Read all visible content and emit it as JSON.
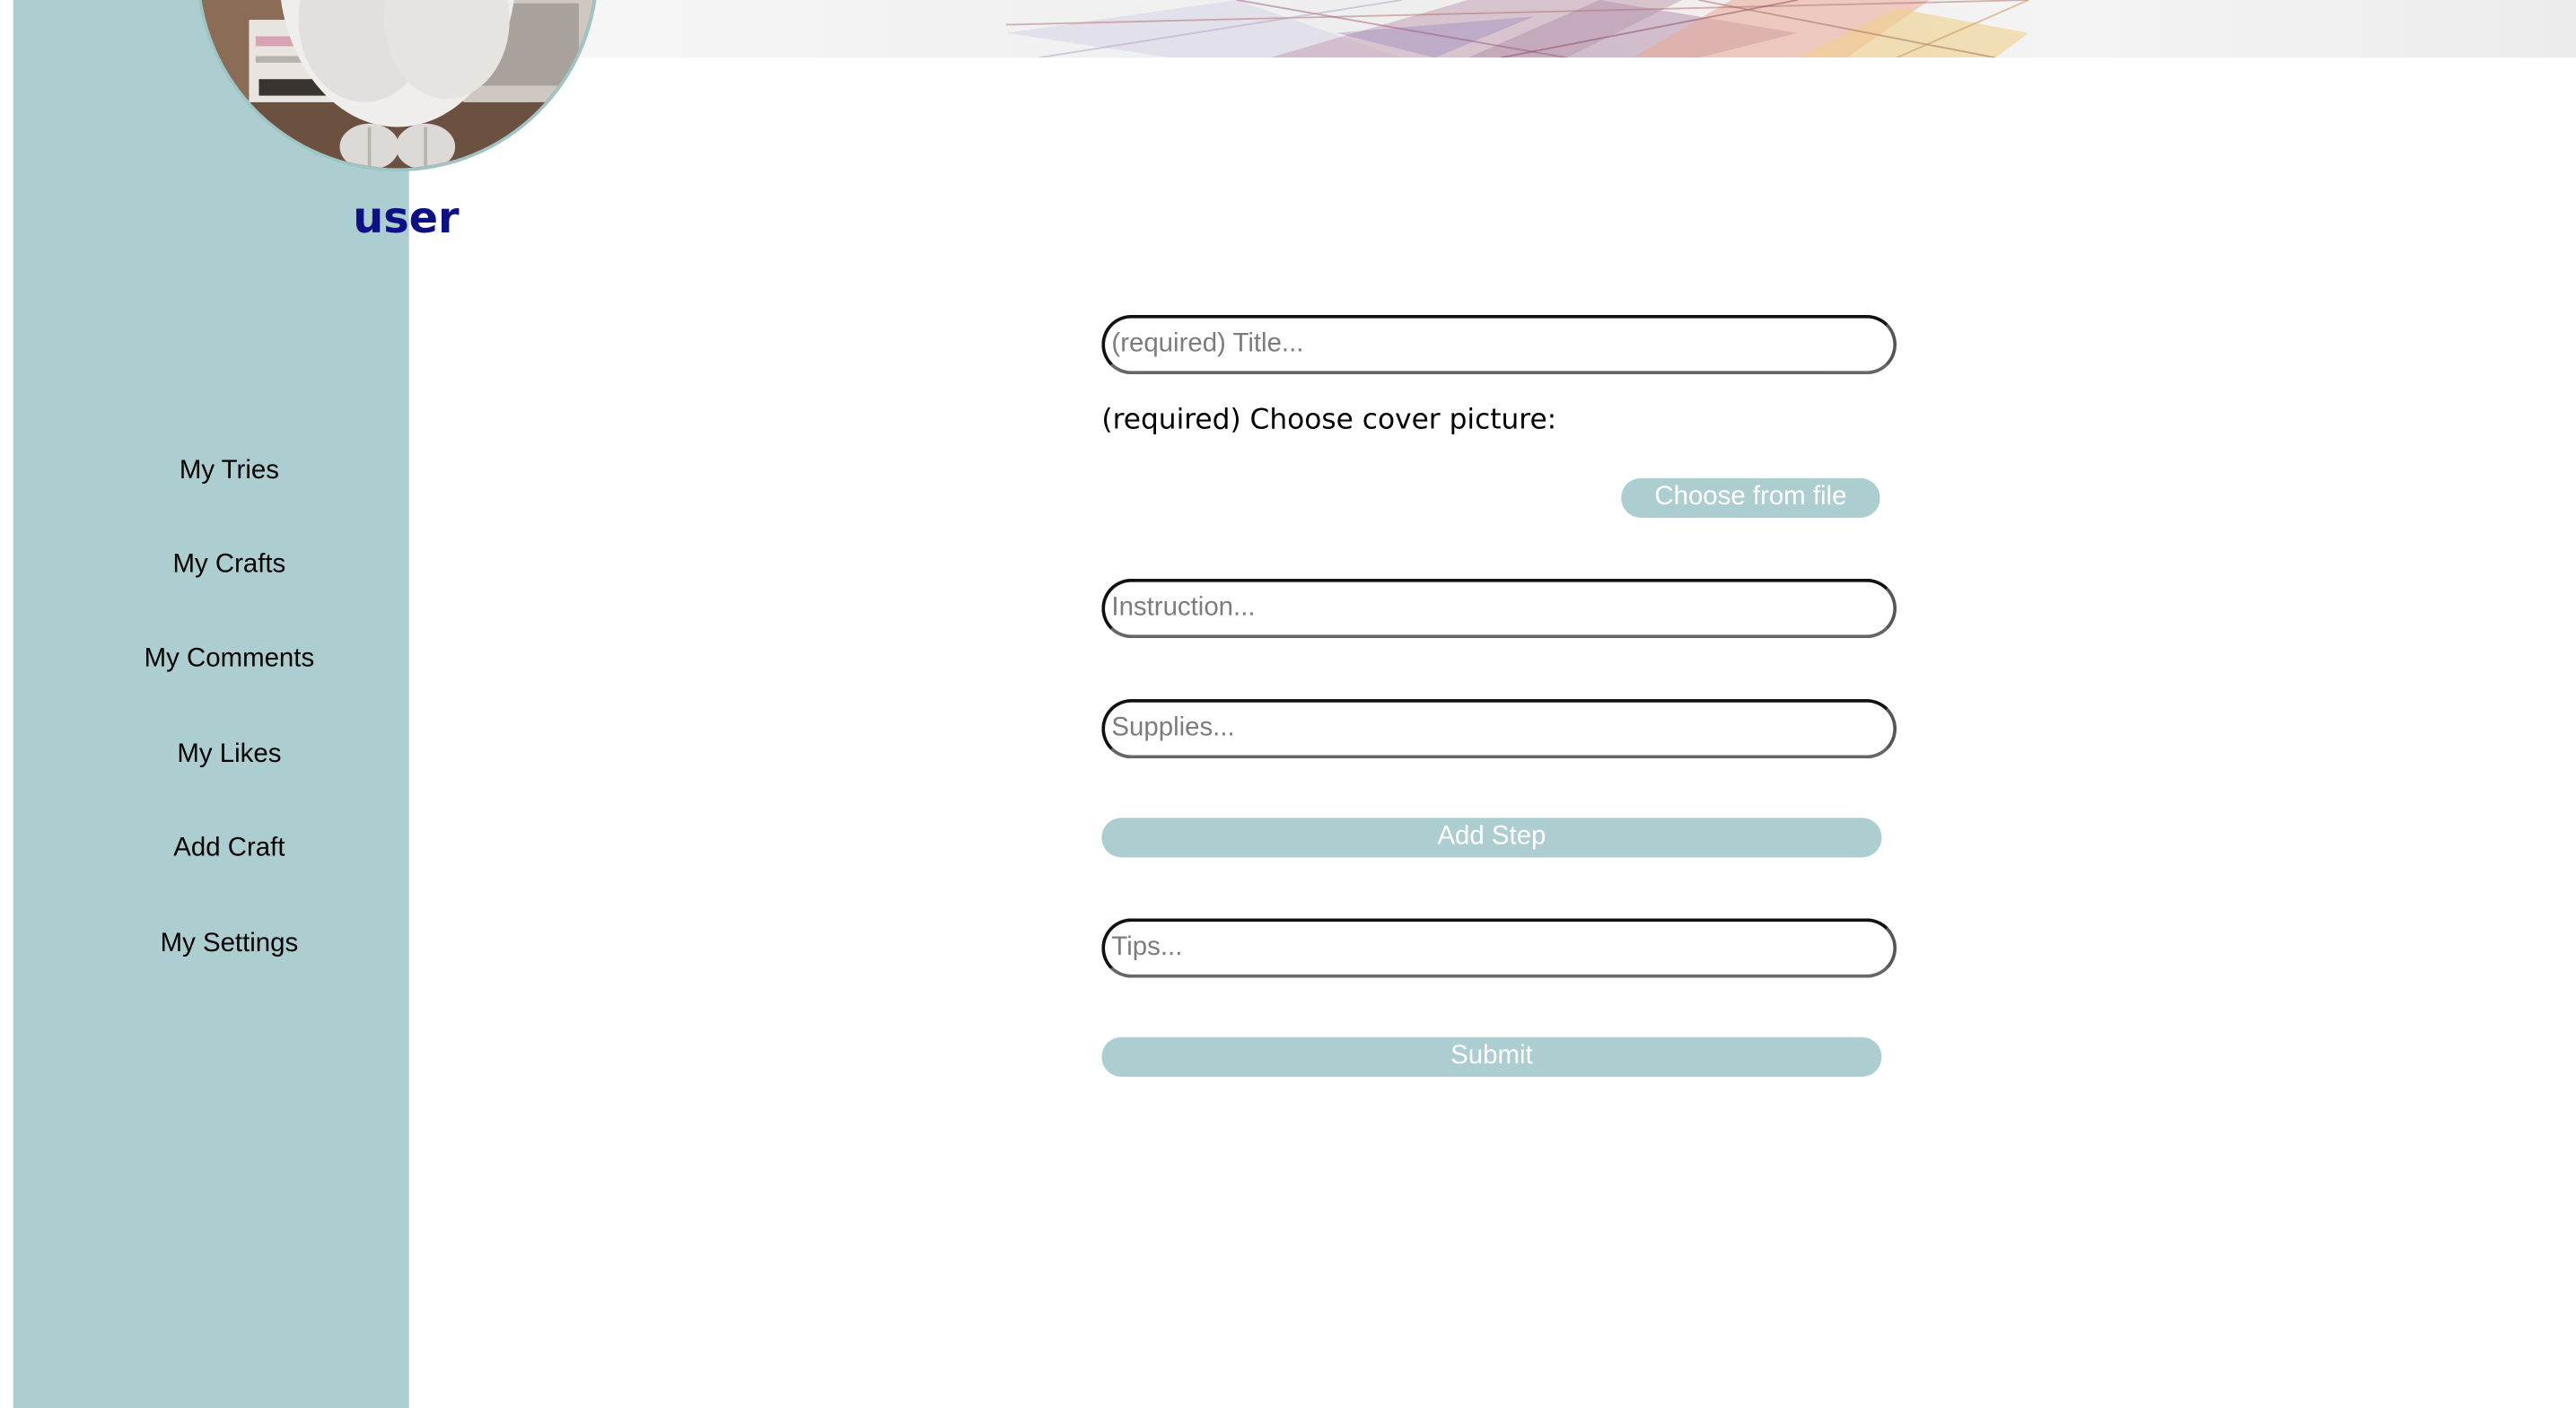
{
  "user": {
    "name": "user",
    "avatar_icon": "cat-photo-avatar"
  },
  "sidebar": {
    "items": [
      {
        "label": "My Tries"
      },
      {
        "label": "My Crafts"
      },
      {
        "label": "My Comments"
      },
      {
        "label": "My Likes"
      },
      {
        "label": "Add Craft"
      },
      {
        "label": "My Settings"
      }
    ]
  },
  "form": {
    "title_placeholder": "(required) Title...",
    "cover_label": "(required) Choose cover picture:",
    "choose_file_label": "Choose from file",
    "instruction_placeholder": "Instruction...",
    "supplies_placeholder": "Supplies...",
    "add_step_label": "Add Step",
    "tips_placeholder": "Tips...",
    "submit_label": "Submit"
  },
  "colors": {
    "sidebar_bg": "#acced0",
    "button_bg": "#acced0",
    "username_color": "#0c1185"
  }
}
